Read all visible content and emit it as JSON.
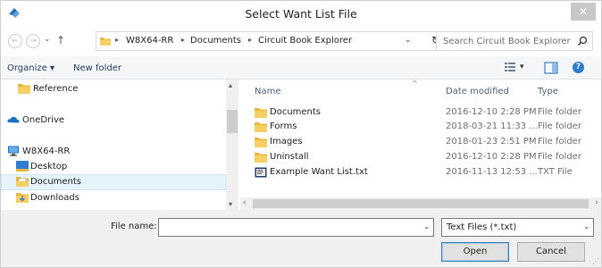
{
  "window": {
    "title": "Select Want List File",
    "close_label": "✕"
  },
  "nav": {
    "back": "←",
    "forward": "→",
    "recent": "⌄",
    "up": "↑"
  },
  "address": {
    "crumbs": [
      "W8X64-RR",
      "Documents",
      "Circuit Book Explorer"
    ],
    "separator": "▸",
    "dropdown": "⌄",
    "refresh": "↻"
  },
  "search": {
    "placeholder": "Search Circuit Book Explorer"
  },
  "toolbar": {
    "organize_label": "Organize",
    "organize_arrow": "▾",
    "new_folder_label": "New folder",
    "view_arrow": "▾",
    "help": "?"
  },
  "navpane": {
    "items": [
      {
        "label": "Reference",
        "icon": "folder-icon"
      },
      {
        "label": "OneDrive",
        "icon": "onedrive-icon"
      },
      {
        "label": "W8X64-RR",
        "icon": "computer-icon"
      },
      {
        "label": "Desktop",
        "icon": "desktop-icon"
      },
      {
        "label": "Documents",
        "icon": "documents-icon",
        "selected": true
      },
      {
        "label": "Downloads",
        "icon": "downloads-icon"
      }
    ],
    "scroll_up": "▴",
    "scroll_down": "▾"
  },
  "filelist": {
    "columns": {
      "name": "Name",
      "date": "Date modified",
      "type": "Type"
    },
    "sort_arrow": "^",
    "rows": [
      {
        "name": "Documents",
        "date": "2016-12-10 2:28 PM",
        "type": "File folder",
        "icon": "folder-icon"
      },
      {
        "name": "Forms",
        "date": "2018-03-21 11:33 ...",
        "type": "File folder",
        "icon": "folder-icon"
      },
      {
        "name": "Images",
        "date": "2018-01-23 2:51 PM",
        "type": "File folder",
        "icon": "folder-icon"
      },
      {
        "name": "Uninstall",
        "date": "2016-12-10 2:28 PM",
        "type": "File folder",
        "icon": "folder-icon"
      },
      {
        "name": "Example Want List.txt",
        "date": "2016-11-13 12:53 ...",
        "type": "TXT File",
        "icon": "text-file-icon"
      }
    ],
    "scroll_left": "‹",
    "scroll_right": "›"
  },
  "bottom": {
    "file_name_label": "File name:",
    "file_name_value": "",
    "file_name_arrow": "⌄",
    "filter_value": "Text Files (*.txt)",
    "filter_arrow": "⌄",
    "open_label": "Open",
    "cancel_label": "Cancel"
  },
  "colors": {
    "folder": "#e8b83b",
    "accent": "#3c7fb1",
    "toolbar_text": "#1e395b"
  }
}
